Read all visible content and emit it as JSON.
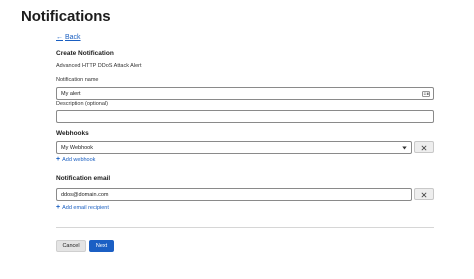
{
  "page": {
    "title": "Notifications"
  },
  "back": {
    "label": "Back"
  },
  "form": {
    "section_title": "Create Notification",
    "notification_type": "Advanced HTTP DDoS Attack Alert",
    "name_label": "Notification name",
    "name_value": "My alert",
    "description_label": "Description (optional)",
    "description_value": ""
  },
  "webhooks": {
    "title": "Webhooks",
    "selected": "My Webhook",
    "add_label": "Add webhook"
  },
  "email": {
    "title": "Notification email",
    "value": "ddos@domain.com",
    "add_label": "Add email recipient"
  },
  "actions": {
    "cancel_label": "Cancel",
    "next_label": "Next"
  },
  "colors": {
    "accent": "#1b5fc4",
    "link": "#1a5fc1"
  },
  "icons": {
    "back": "arrow-left-icon",
    "field_card": "contact-card-icon",
    "dropdown": "caret-down-icon",
    "remove": "close-icon",
    "add": "plus-icon"
  }
}
